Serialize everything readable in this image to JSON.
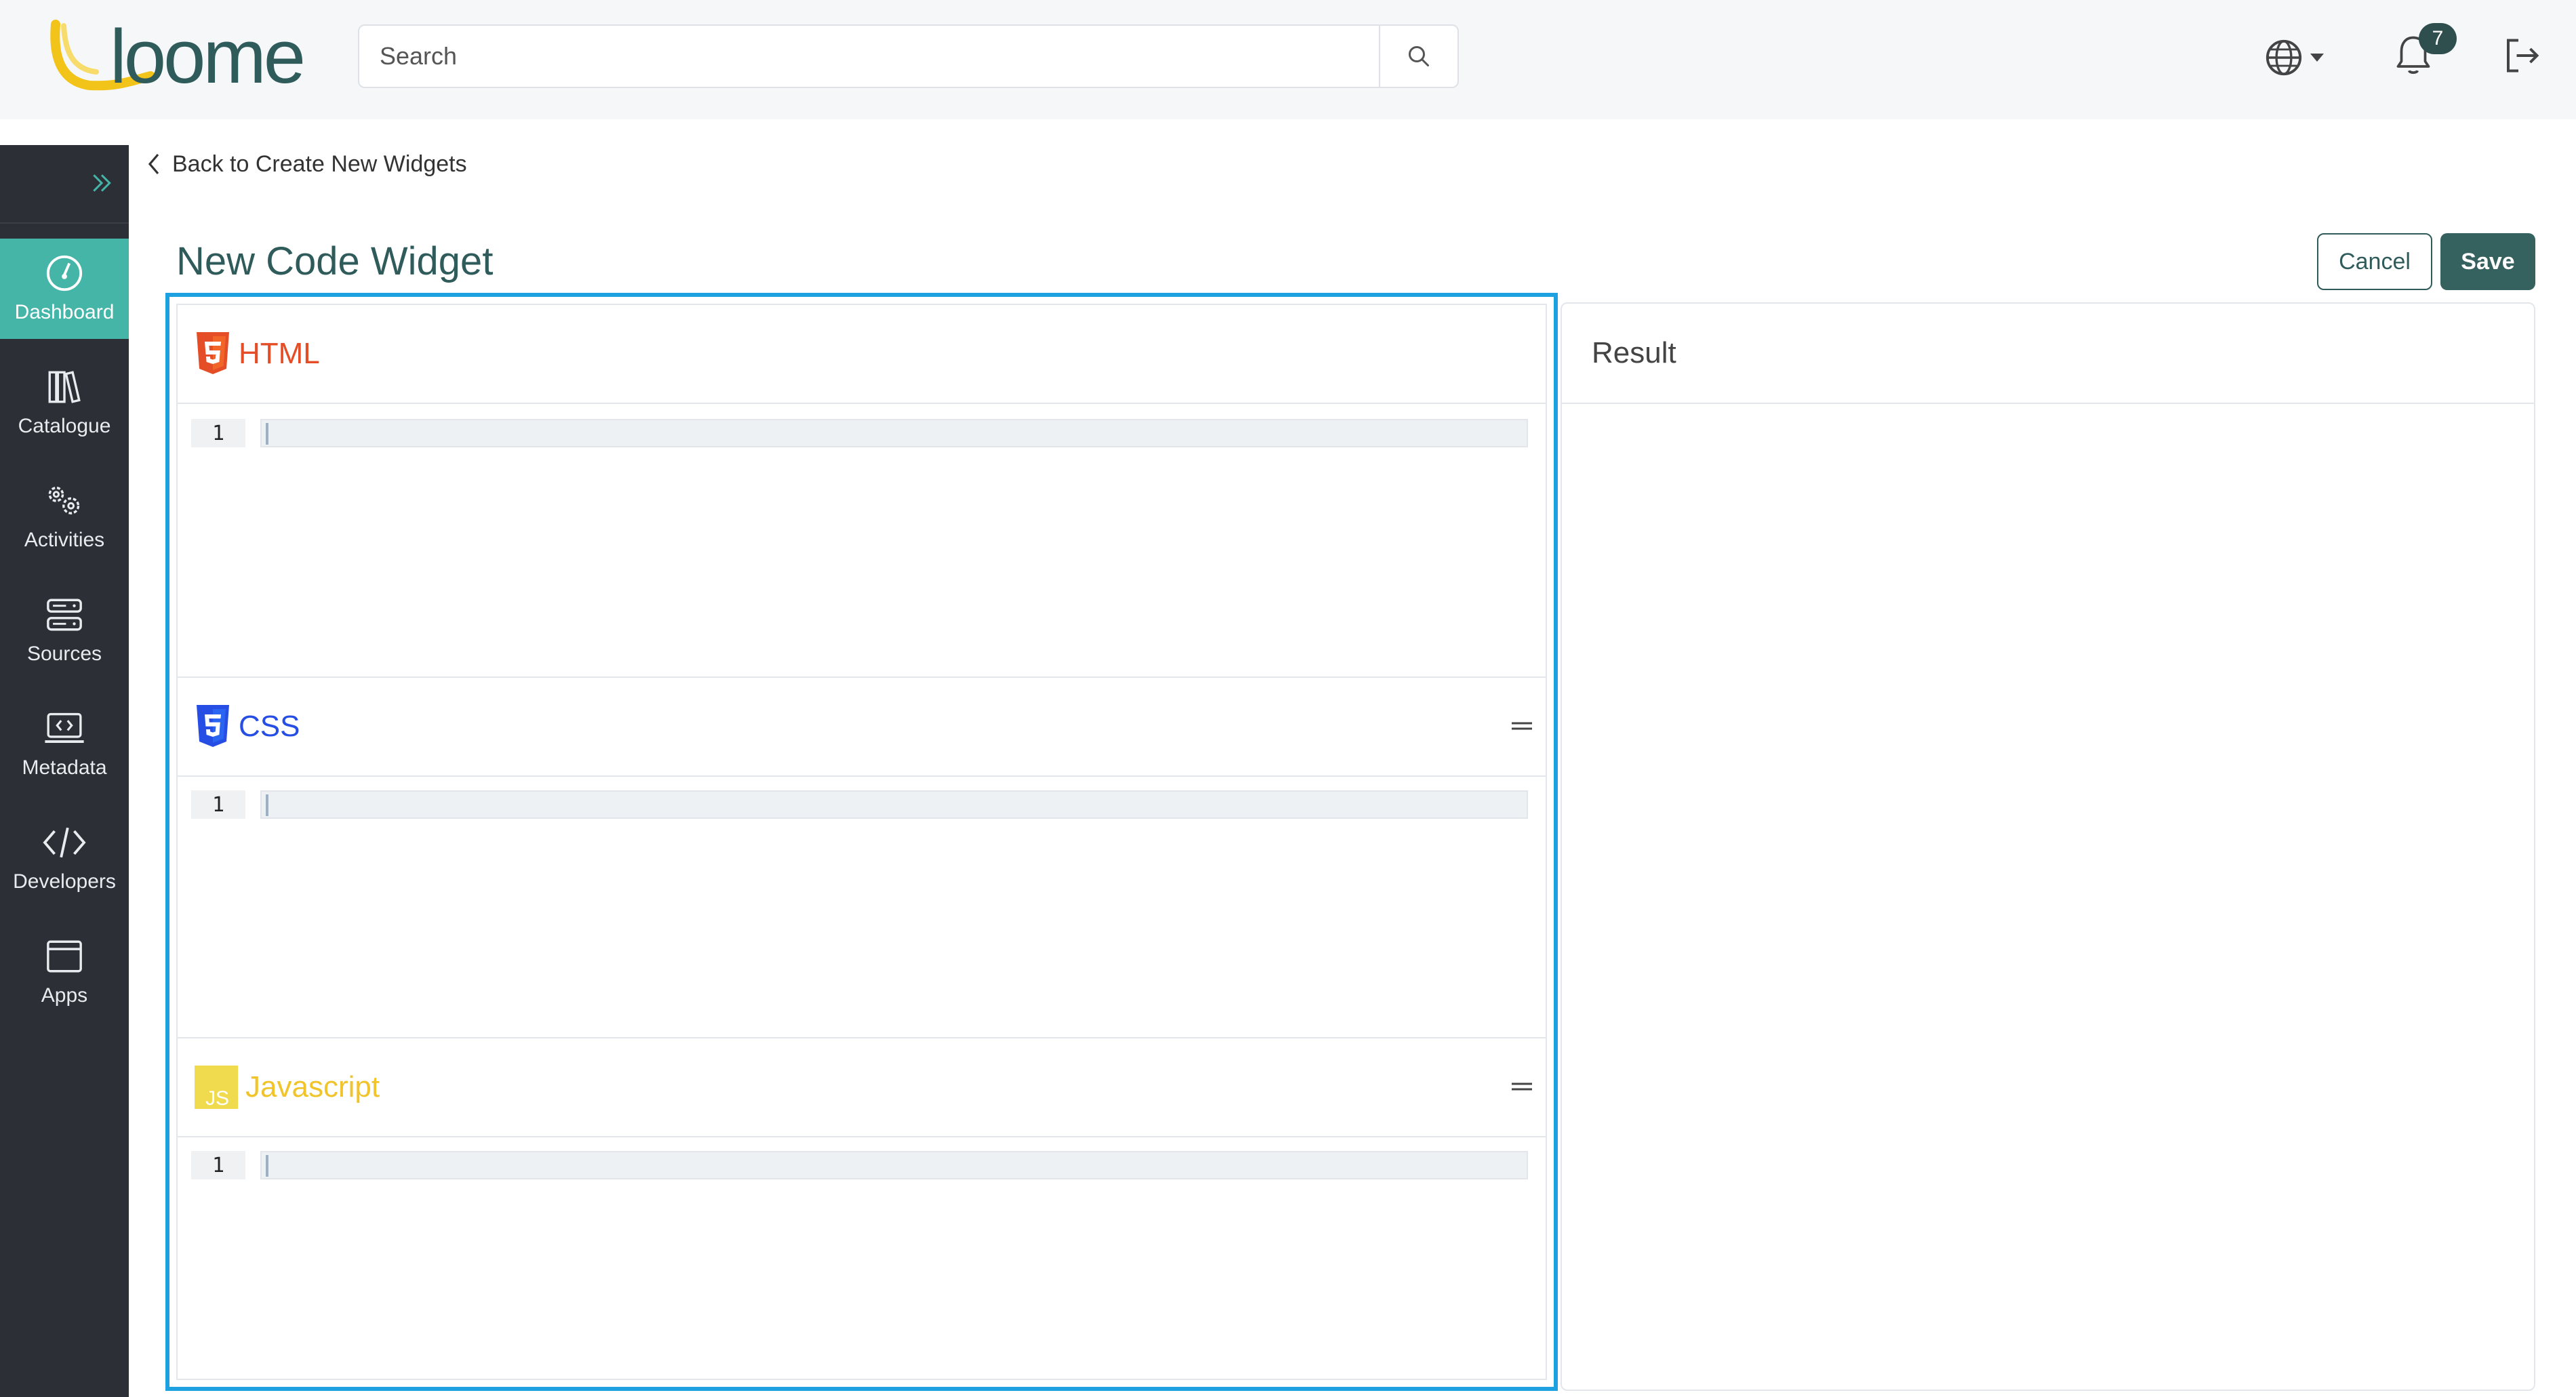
{
  "header": {
    "logo_text": "loome",
    "search": {
      "placeholder": "Search",
      "value": ""
    },
    "notifications_count": "7"
  },
  "sidebar": {
    "items": [
      {
        "label": "Dashboard",
        "icon": "dashboard-icon",
        "active": true
      },
      {
        "label": "Catalogue",
        "icon": "catalogue-icon",
        "active": false
      },
      {
        "label": "Activities",
        "icon": "activities-icon",
        "active": false
      },
      {
        "label": "Sources",
        "icon": "sources-icon",
        "active": false
      },
      {
        "label": "Metadata",
        "icon": "metadata-icon",
        "active": false
      },
      {
        "label": "Developers",
        "icon": "developers-icon",
        "active": false
      },
      {
        "label": "Apps",
        "icon": "apps-icon",
        "active": false
      }
    ]
  },
  "page": {
    "back_link": "Back to Create New Widgets",
    "title": "New Code Widget",
    "cancel_label": "Cancel",
    "save_label": "Save"
  },
  "editors": [
    {
      "label": "HTML",
      "color": "#e44d26",
      "line_number": "1"
    },
    {
      "label": "CSS",
      "color": "#264de4",
      "line_number": "1"
    },
    {
      "label": "Javascript",
      "color": "#f0db4f",
      "line_number": "1"
    }
  ],
  "result": {
    "title": "Result"
  },
  "colors": {
    "accent": "#45b5a8",
    "primary_dark": "#35615e",
    "sidebar_bg": "#2c3036",
    "selection_border": "#1da1e0"
  }
}
